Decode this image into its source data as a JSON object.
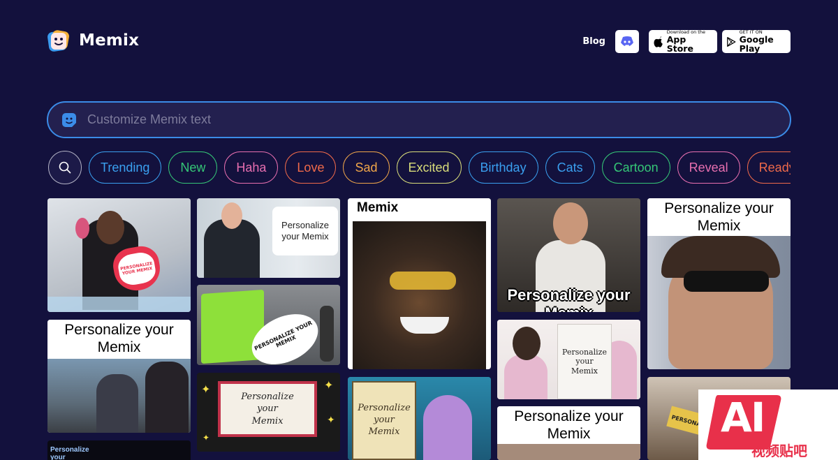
{
  "brand": {
    "name": "Memix"
  },
  "nav": {
    "blog": "Blog",
    "appstore_small": "Download on the",
    "appstore_big": "App Store",
    "googleplay_small": "GET IT ON",
    "googleplay_big": "Google Play"
  },
  "search": {
    "placeholder": "Customize Memix text"
  },
  "categories": [
    {
      "label": "Trending",
      "color": "#3aa0f0"
    },
    {
      "label": "New",
      "color": "#35c777"
    },
    {
      "label": "Haha",
      "color": "#e86fb0"
    },
    {
      "label": "Love",
      "color": "#f06a4a"
    },
    {
      "label": "Sad",
      "color": "#f0a64a"
    },
    {
      "label": "Excited",
      "color": "#d9dd7a"
    },
    {
      "label": "Birthday",
      "color": "#3aa0f0"
    },
    {
      "label": "Cats",
      "color": "#3aa0f0"
    },
    {
      "label": "Cartoon",
      "color": "#35c777"
    },
    {
      "label": "Reveal",
      "color": "#e86fb0"
    },
    {
      "label": "Ready",
      "color": "#f06a4a"
    }
  ],
  "tiles": {
    "t1_heart": "PERSONALIZE YOUR MEMIX",
    "t2_caption_a": "Personalize your",
    "t2_caption_b": "Memix",
    "t3_caption_a": "Personalize",
    "t3_caption_b": "your",
    "t4_sign_a": "Personalize",
    "t4_sign_b": "your Memix",
    "t5_sign": "PERSONALIZE YOUR MEMIX",
    "t6_sign_a": "Personalize",
    "t6_sign_b": "your",
    "t6_sign_c": "Memix",
    "t7_caption": "Memix",
    "t8_sign_a": "Personalize",
    "t8_sign_b": "your",
    "t8_sign_c": "Memix",
    "t9_caption_a": "Personalize your",
    "t9_caption_b": "Memix",
    "t10_sign_a": "Personalize",
    "t10_sign_b": "your",
    "t10_sign_c": "Memix",
    "t11_caption_a": "Personalize your",
    "t11_caption_b": "Memix",
    "t12_caption_a": "Personalize your",
    "t12_caption_b": "Memix",
    "t13_sign": "PERSONALIZE"
  },
  "watermark": {
    "big": "AI",
    "small": "视频贴吧"
  }
}
